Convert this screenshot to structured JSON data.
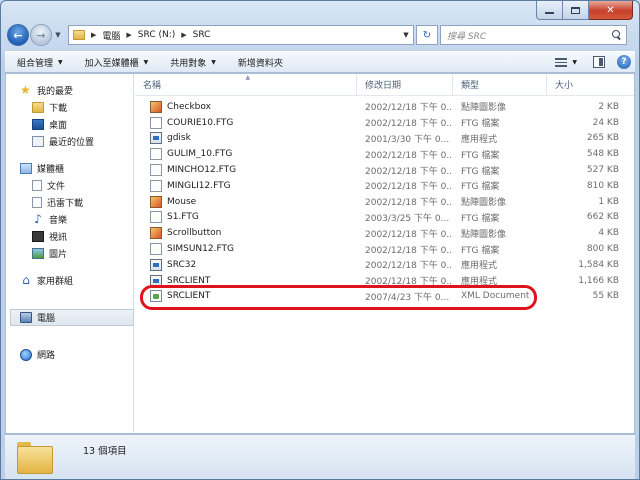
{
  "nav": {
    "breadcrumb": [
      "電腦",
      "SRC (N:)",
      "SRC"
    ],
    "search_placeholder": "搜尋 SRC"
  },
  "toolbar": {
    "organize": "組合管理",
    "add_to_library": "加入至媒體櫃",
    "share_with": "共用對象",
    "new_folder": "新增資料夾"
  },
  "sidebar": {
    "favorites": "我的最愛",
    "downloads": "下載",
    "desktop": "桌面",
    "recent": "最近的位置",
    "libraries": "媒體櫃",
    "documents": "文件",
    "thunder": "迅雷下載",
    "music": "音樂",
    "videos": "視訊",
    "pictures": "圖片",
    "homegroup": "家用群組",
    "computer": "電腦",
    "network": "網路"
  },
  "columns": {
    "name": "名稱",
    "date": "修改日期",
    "type": "類型",
    "size": "大小"
  },
  "files": [
    {
      "name": "Checkbox",
      "date": "2002/12/18 下午 0...",
      "type": "點陣圖影像",
      "size": "2 KB",
      "icon": "bitmap-icon"
    },
    {
      "name": "COURIE10.FTG",
      "date": "2002/12/18 下午 0...",
      "type": "FTG 檔案",
      "size": "24 KB",
      "icon": "file-icon"
    },
    {
      "name": "gdisk",
      "date": "2001/3/30 下午 0...",
      "type": "應用程式",
      "size": "265 KB",
      "icon": "exe-icon"
    },
    {
      "name": "GULIM_10.FTG",
      "date": "2002/12/18 下午 0...",
      "type": "FTG 檔案",
      "size": "548 KB",
      "icon": "file-icon"
    },
    {
      "name": "MINCHO12.FTG",
      "date": "2002/12/18 下午 0...",
      "type": "FTG 檔案",
      "size": "527 KB",
      "icon": "file-icon"
    },
    {
      "name": "MINGLI12.FTG",
      "date": "2002/12/18 下午 0...",
      "type": "FTG 檔案",
      "size": "810 KB",
      "icon": "file-icon"
    },
    {
      "name": "Mouse",
      "date": "2002/12/18 下午 0...",
      "type": "點陣圖影像",
      "size": "1 KB",
      "icon": "bitmap-icon"
    },
    {
      "name": "S1.FTG",
      "date": "2003/3/25 下午 0...",
      "type": "FTG 檔案",
      "size": "662 KB",
      "icon": "file-icon"
    },
    {
      "name": "Scrollbutton",
      "date": "2002/12/18 下午 0...",
      "type": "點陣圖影像",
      "size": "4 KB",
      "icon": "bitmap-icon"
    },
    {
      "name": "SIMSUN12.FTG",
      "date": "2002/12/18 下午 0...",
      "type": "FTG 檔案",
      "size": "800 KB",
      "icon": "file-icon"
    },
    {
      "name": "SRC32",
      "date": "2002/12/18 下午 0...",
      "type": "應用程式",
      "size": "1,584 KB",
      "icon": "exe-icon"
    },
    {
      "name": "SRCLIENT",
      "date": "2002/12/18 下午 0...",
      "type": "應用程式",
      "size": "1,166 KB",
      "icon": "exe-icon"
    },
    {
      "name": "SRCLIENT",
      "date": "2007/4/23 下午 0...",
      "type": "XML Document",
      "size": "55 KB",
      "icon": "xml-icon"
    }
  ],
  "status": {
    "count": "13 個項目"
  },
  "colors": {
    "highlight": "#e0121c"
  }
}
